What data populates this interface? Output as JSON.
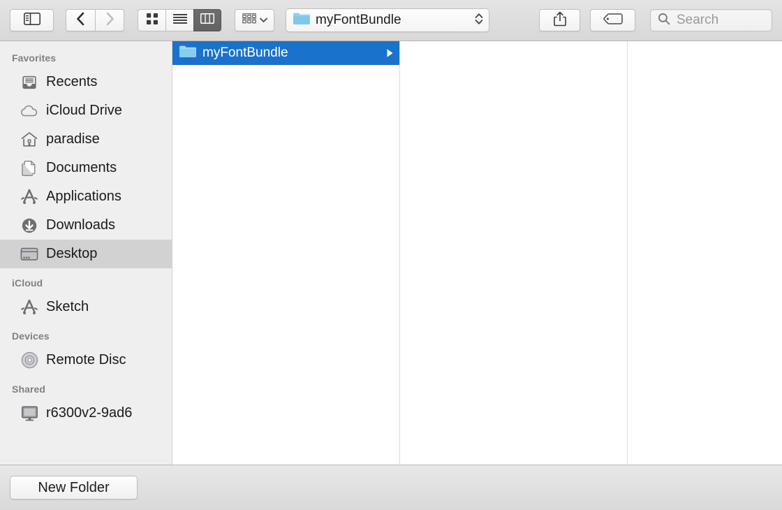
{
  "toolbar": {
    "sidebar_toggle_icon": "sidebar-toggle-icon",
    "back_icon": "chevron-left-icon",
    "forward_icon": "chevron-right-icon",
    "view_icon_grid": "icon-view-icon",
    "view_list": "list-view-icon",
    "view_column": "column-view-icon",
    "arrange_icon": "arrange-group-icon",
    "arrange_chevron": "chevron-down-icon",
    "path_label": "myFontBundle",
    "path_folder_icon": "folder-icon",
    "path_stepper_icon": "up-down-chevron-icon",
    "share_icon": "share-icon",
    "tag_icon": "tag-icon",
    "search_icon": "search-icon",
    "search_placeholder": "Search",
    "search_value": ""
  },
  "sidebar": {
    "groups": [
      {
        "title": "Favorites",
        "items": [
          {
            "label": "Recents",
            "icon": "recents-icon",
            "selected": false
          },
          {
            "label": "iCloud Drive",
            "icon": "cloud-icon",
            "selected": false
          },
          {
            "label": "paradise",
            "icon": "home-icon",
            "selected": false
          },
          {
            "label": "Documents",
            "icon": "documents-icon",
            "selected": false
          },
          {
            "label": "Applications",
            "icon": "applications-icon",
            "selected": false
          },
          {
            "label": "Downloads",
            "icon": "downloads-icon",
            "selected": false
          },
          {
            "label": "Desktop",
            "icon": "desktop-icon",
            "selected": true
          }
        ]
      },
      {
        "title": "iCloud",
        "items": [
          {
            "label": "Sketch",
            "icon": "applications-icon",
            "selected": false
          }
        ]
      },
      {
        "title": "Devices",
        "items": [
          {
            "label": "Remote Disc",
            "icon": "disc-icon",
            "selected": false
          }
        ]
      },
      {
        "title": "Shared",
        "items": [
          {
            "label": "r6300v2-9ad6",
            "icon": "display-icon",
            "selected": false
          }
        ]
      }
    ]
  },
  "columns": [
    {
      "rows": [
        {
          "name": "myFontBundle",
          "icon": "folder-icon",
          "selected": true,
          "has_children": true
        }
      ]
    },
    {
      "rows": []
    },
    {
      "rows": []
    }
  ],
  "footer": {
    "new_folder_label": "New Folder"
  },
  "colors": {
    "selection_blue": "#1a72cb",
    "sidebar_bg": "#efeff0",
    "sidebar_selected": "#d2d2d2",
    "folder_blue": "#7ec8ed",
    "icon_gray": "#808084"
  }
}
